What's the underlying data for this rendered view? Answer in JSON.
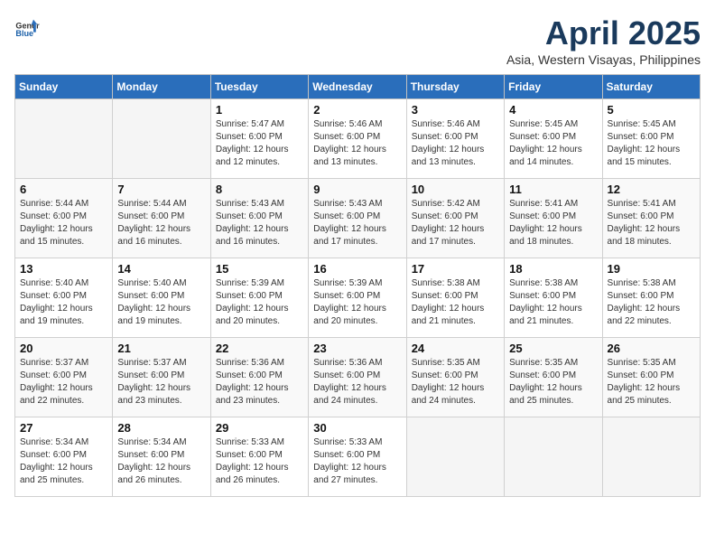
{
  "header": {
    "logo_general": "General",
    "logo_blue": "Blue",
    "month_year": "April 2025",
    "subtitle": "Asia, Western Visayas, Philippines"
  },
  "weekdays": [
    "Sunday",
    "Monday",
    "Tuesday",
    "Wednesday",
    "Thursday",
    "Friday",
    "Saturday"
  ],
  "weeks": [
    [
      {
        "day": "",
        "sunrise": "",
        "sunset": "",
        "daylight": ""
      },
      {
        "day": "",
        "sunrise": "",
        "sunset": "",
        "daylight": ""
      },
      {
        "day": "1",
        "sunrise": "Sunrise: 5:47 AM",
        "sunset": "Sunset: 6:00 PM",
        "daylight": "Daylight: 12 hours and 12 minutes."
      },
      {
        "day": "2",
        "sunrise": "Sunrise: 5:46 AM",
        "sunset": "Sunset: 6:00 PM",
        "daylight": "Daylight: 12 hours and 13 minutes."
      },
      {
        "day": "3",
        "sunrise": "Sunrise: 5:46 AM",
        "sunset": "Sunset: 6:00 PM",
        "daylight": "Daylight: 12 hours and 13 minutes."
      },
      {
        "day": "4",
        "sunrise": "Sunrise: 5:45 AM",
        "sunset": "Sunset: 6:00 PM",
        "daylight": "Daylight: 12 hours and 14 minutes."
      },
      {
        "day": "5",
        "sunrise": "Sunrise: 5:45 AM",
        "sunset": "Sunset: 6:00 PM",
        "daylight": "Daylight: 12 hours and 15 minutes."
      }
    ],
    [
      {
        "day": "6",
        "sunrise": "Sunrise: 5:44 AM",
        "sunset": "Sunset: 6:00 PM",
        "daylight": "Daylight: 12 hours and 15 minutes."
      },
      {
        "day": "7",
        "sunrise": "Sunrise: 5:44 AM",
        "sunset": "Sunset: 6:00 PM",
        "daylight": "Daylight: 12 hours and 16 minutes."
      },
      {
        "day": "8",
        "sunrise": "Sunrise: 5:43 AM",
        "sunset": "Sunset: 6:00 PM",
        "daylight": "Daylight: 12 hours and 16 minutes."
      },
      {
        "day": "9",
        "sunrise": "Sunrise: 5:43 AM",
        "sunset": "Sunset: 6:00 PM",
        "daylight": "Daylight: 12 hours and 17 minutes."
      },
      {
        "day": "10",
        "sunrise": "Sunrise: 5:42 AM",
        "sunset": "Sunset: 6:00 PM",
        "daylight": "Daylight: 12 hours and 17 minutes."
      },
      {
        "day": "11",
        "sunrise": "Sunrise: 5:41 AM",
        "sunset": "Sunset: 6:00 PM",
        "daylight": "Daylight: 12 hours and 18 minutes."
      },
      {
        "day": "12",
        "sunrise": "Sunrise: 5:41 AM",
        "sunset": "Sunset: 6:00 PM",
        "daylight": "Daylight: 12 hours and 18 minutes."
      }
    ],
    [
      {
        "day": "13",
        "sunrise": "Sunrise: 5:40 AM",
        "sunset": "Sunset: 6:00 PM",
        "daylight": "Daylight: 12 hours and 19 minutes."
      },
      {
        "day": "14",
        "sunrise": "Sunrise: 5:40 AM",
        "sunset": "Sunset: 6:00 PM",
        "daylight": "Daylight: 12 hours and 19 minutes."
      },
      {
        "day": "15",
        "sunrise": "Sunrise: 5:39 AM",
        "sunset": "Sunset: 6:00 PM",
        "daylight": "Daylight: 12 hours and 20 minutes."
      },
      {
        "day": "16",
        "sunrise": "Sunrise: 5:39 AM",
        "sunset": "Sunset: 6:00 PM",
        "daylight": "Daylight: 12 hours and 20 minutes."
      },
      {
        "day": "17",
        "sunrise": "Sunrise: 5:38 AM",
        "sunset": "Sunset: 6:00 PM",
        "daylight": "Daylight: 12 hours and 21 minutes."
      },
      {
        "day": "18",
        "sunrise": "Sunrise: 5:38 AM",
        "sunset": "Sunset: 6:00 PM",
        "daylight": "Daylight: 12 hours and 21 minutes."
      },
      {
        "day": "19",
        "sunrise": "Sunrise: 5:38 AM",
        "sunset": "Sunset: 6:00 PM",
        "daylight": "Daylight: 12 hours and 22 minutes."
      }
    ],
    [
      {
        "day": "20",
        "sunrise": "Sunrise: 5:37 AM",
        "sunset": "Sunset: 6:00 PM",
        "daylight": "Daylight: 12 hours and 22 minutes."
      },
      {
        "day": "21",
        "sunrise": "Sunrise: 5:37 AM",
        "sunset": "Sunset: 6:00 PM",
        "daylight": "Daylight: 12 hours and 23 minutes."
      },
      {
        "day": "22",
        "sunrise": "Sunrise: 5:36 AM",
        "sunset": "Sunset: 6:00 PM",
        "daylight": "Daylight: 12 hours and 23 minutes."
      },
      {
        "day": "23",
        "sunrise": "Sunrise: 5:36 AM",
        "sunset": "Sunset: 6:00 PM",
        "daylight": "Daylight: 12 hours and 24 minutes."
      },
      {
        "day": "24",
        "sunrise": "Sunrise: 5:35 AM",
        "sunset": "Sunset: 6:00 PM",
        "daylight": "Daylight: 12 hours and 24 minutes."
      },
      {
        "day": "25",
        "sunrise": "Sunrise: 5:35 AM",
        "sunset": "Sunset: 6:00 PM",
        "daylight": "Daylight: 12 hours and 25 minutes."
      },
      {
        "day": "26",
        "sunrise": "Sunrise: 5:35 AM",
        "sunset": "Sunset: 6:00 PM",
        "daylight": "Daylight: 12 hours and 25 minutes."
      }
    ],
    [
      {
        "day": "27",
        "sunrise": "Sunrise: 5:34 AM",
        "sunset": "Sunset: 6:00 PM",
        "daylight": "Daylight: 12 hours and 25 minutes."
      },
      {
        "day": "28",
        "sunrise": "Sunrise: 5:34 AM",
        "sunset": "Sunset: 6:00 PM",
        "daylight": "Daylight: 12 hours and 26 minutes."
      },
      {
        "day": "29",
        "sunrise": "Sunrise: 5:33 AM",
        "sunset": "Sunset: 6:00 PM",
        "daylight": "Daylight: 12 hours and 26 minutes."
      },
      {
        "day": "30",
        "sunrise": "Sunrise: 5:33 AM",
        "sunset": "Sunset: 6:00 PM",
        "daylight": "Daylight: 12 hours and 27 minutes."
      },
      {
        "day": "",
        "sunrise": "",
        "sunset": "",
        "daylight": ""
      },
      {
        "day": "",
        "sunrise": "",
        "sunset": "",
        "daylight": ""
      },
      {
        "day": "",
        "sunrise": "",
        "sunset": "",
        "daylight": ""
      }
    ]
  ]
}
